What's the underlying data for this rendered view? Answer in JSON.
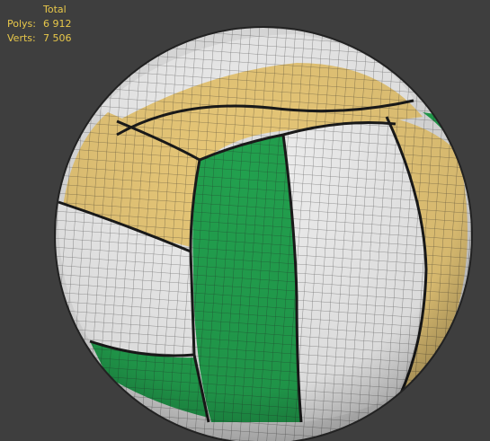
{
  "viewport": {
    "background": "#3e3e3e",
    "statistics": {
      "header": "Total",
      "rows": [
        {
          "label": "Polys:",
          "value": "6 912"
        },
        {
          "label": "Verts:",
          "value": "7 506"
        }
      ],
      "text_color": "#e8c84a"
    },
    "model": {
      "name_visible": false,
      "panel_colors": {
        "green": "#22a04e",
        "white": "#eeeeee",
        "yellow": "#e8c878",
        "wire": "#111111"
      }
    }
  }
}
